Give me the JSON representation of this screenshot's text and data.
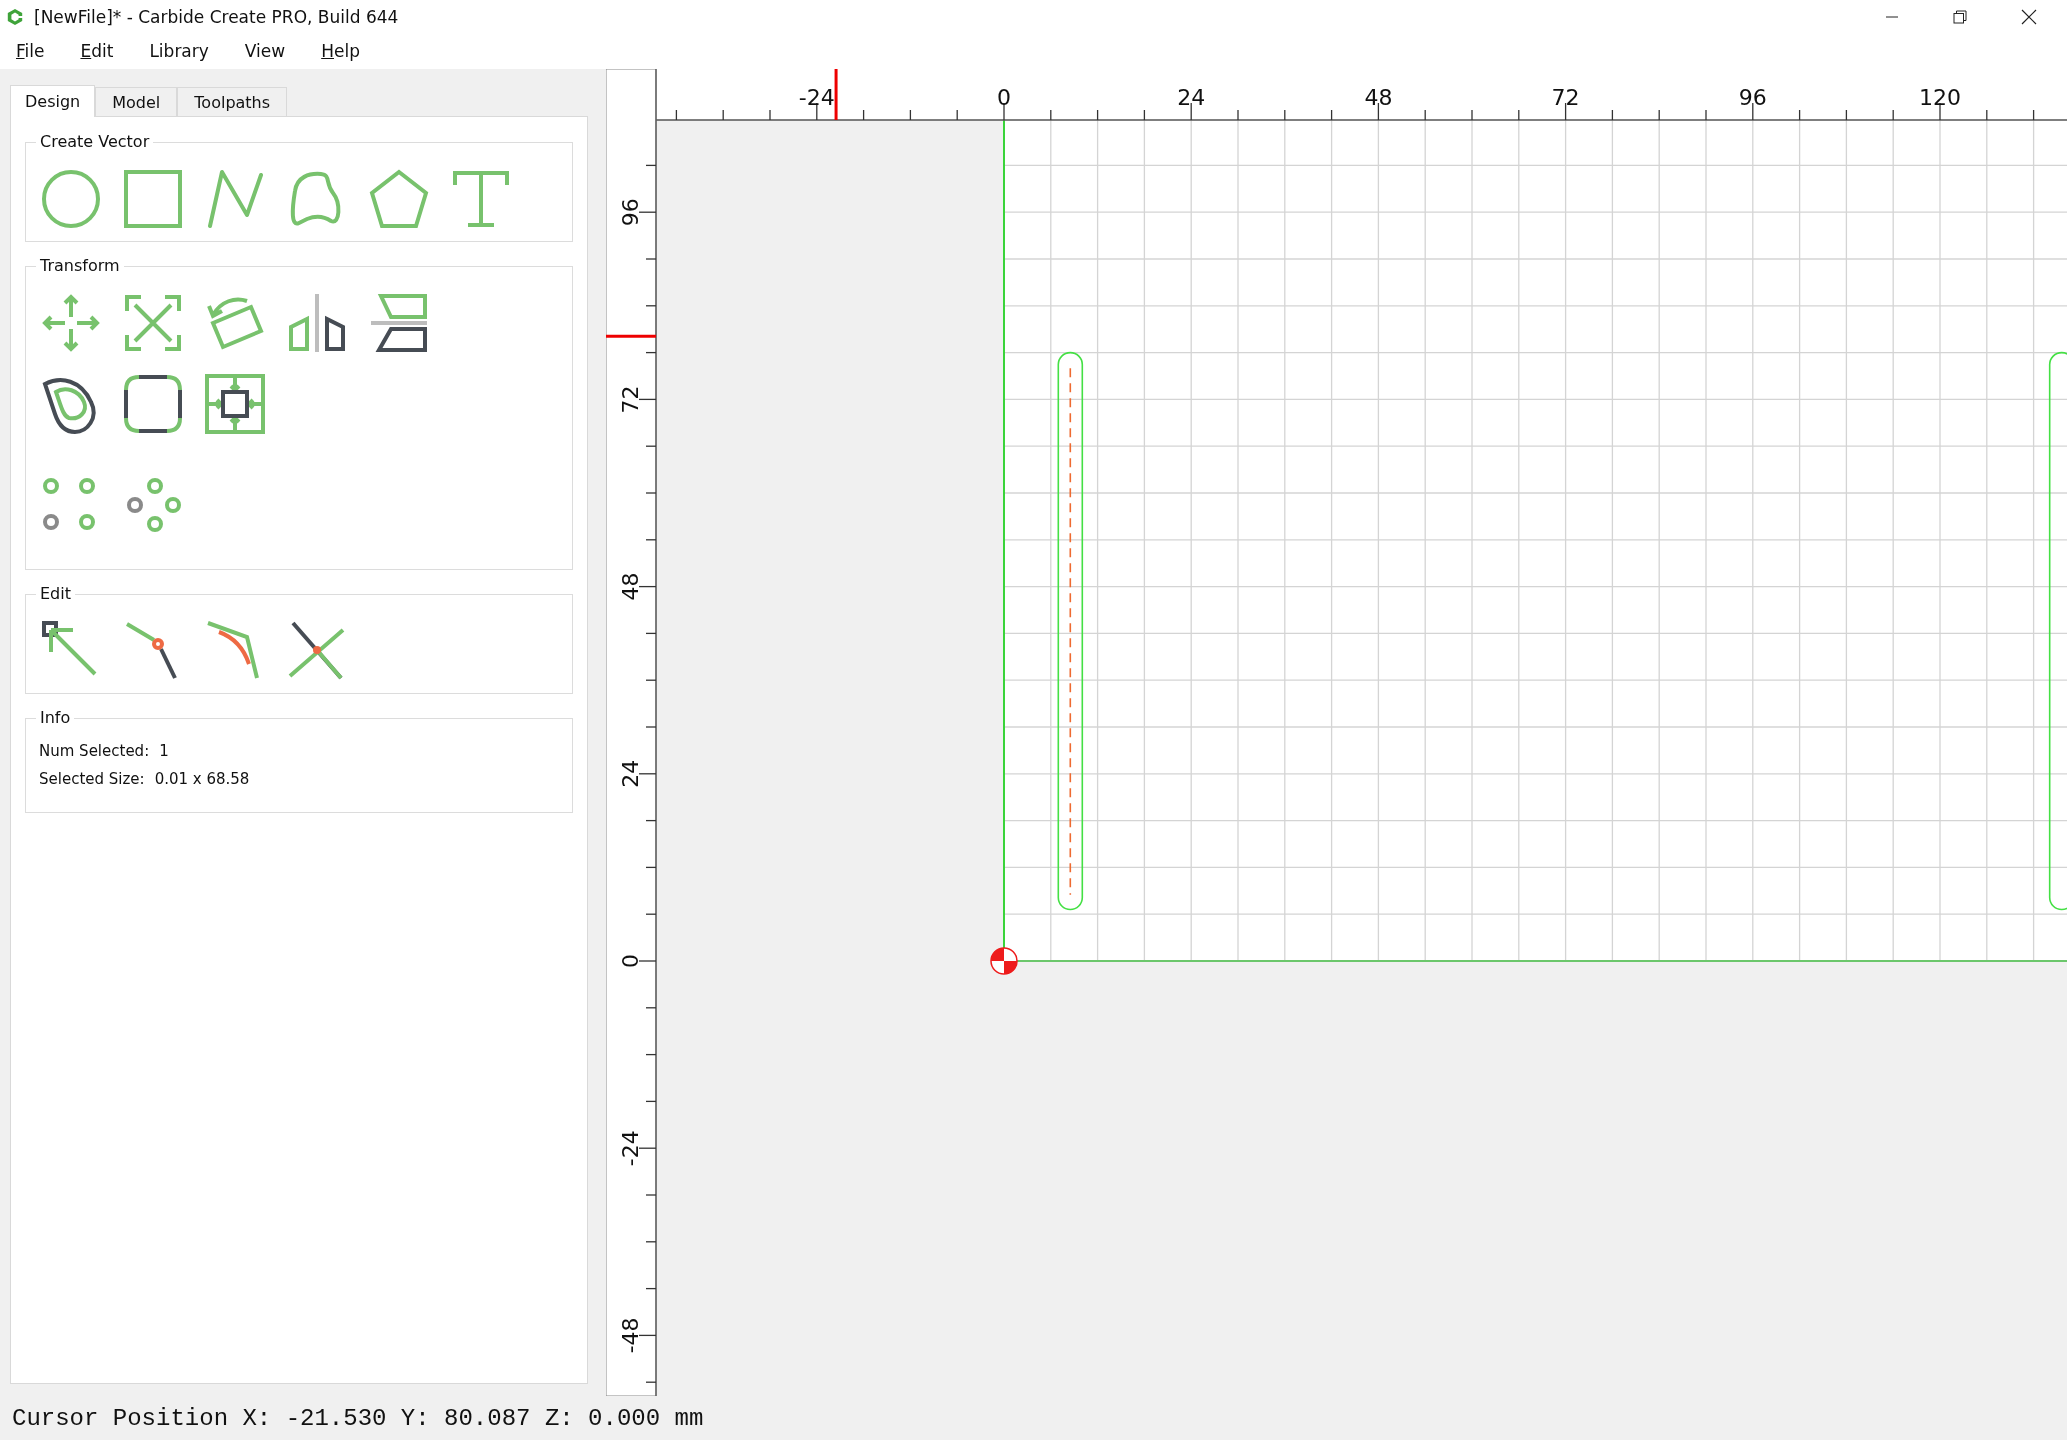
{
  "window": {
    "title": "[NewFile]* - Carbide Create PRO, Build 644"
  },
  "menu": [
    {
      "label": "File",
      "underline_first": true
    },
    {
      "label": "Edit",
      "underline_first": true
    },
    {
      "label": "Library",
      "underline_first": false
    },
    {
      "label": "View",
      "underline_first": false
    },
    {
      "label": "Help",
      "underline_first": true
    }
  ],
  "tabs": [
    {
      "label": "Design",
      "selected": true
    },
    {
      "label": "Model",
      "selected": false
    },
    {
      "label": "Toolpaths",
      "selected": false
    }
  ],
  "panel_groups": [
    {
      "kind": "create_vector",
      "title": "Create Vector"
    },
    {
      "kind": "transform",
      "title": "Transform"
    },
    {
      "kind": "edit",
      "title": "Edit"
    },
    {
      "kind": "info",
      "title": "Info",
      "rows": [
        {
          "label": "Num Selected:",
          "value": "1"
        },
        {
          "label": "Selected Size:",
          "value": "0.01 x 68.58"
        }
      ]
    }
  ],
  "rulers": {
    "horizontal": [
      "-24",
      "0",
      "24",
      "48",
      "72",
      "96",
      "120"
    ],
    "vertical": [
      "96",
      "72",
      "48",
      "24",
      "0",
      "-24",
      "-48"
    ]
  },
  "status_bar": {
    "label": "Cursor Position",
    "x": "X: -21.530",
    "y": "Y: 80.087",
    "z": "Z: 0.000",
    "unit": "mm"
  }
}
